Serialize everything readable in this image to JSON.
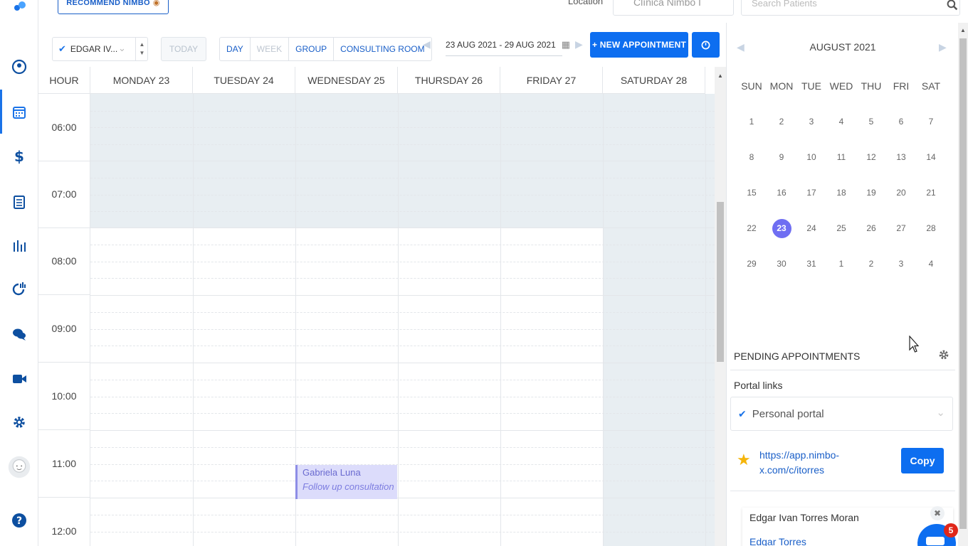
{
  "topbar": {
    "recommend_label": "RECOMMEND NIMBO",
    "location_label": "Location",
    "location_value": "Clínica Nimbo I",
    "search_placeholder": "Search Patients"
  },
  "toolbar": {
    "doctor_select": "EDGAR IV...",
    "today_label": "TODAY",
    "view_tabs": [
      "DAY",
      "WEEK",
      "GROUP",
      "CONSULTING ROOM"
    ],
    "date_range": "23 AUG 2021 - 29 AUG 2021",
    "new_appointment_label": "+ NEW APPOINTMENT"
  },
  "grid": {
    "hour_header": "HOUR",
    "days": [
      "MONDAY 23",
      "TUESDAY 24",
      "WEDNESDAY 25",
      "THURSDAY 26",
      "FRIDAY 27",
      "SATURDAY 28"
    ],
    "hours": [
      "06:00",
      "07:00",
      "08:00",
      "09:00",
      "10:00",
      "11:00",
      "12:00"
    ],
    "appointment": {
      "patient": "Gabriela Luna",
      "type": "Follow up consultation"
    }
  },
  "mini_calendar": {
    "month_title": "AUGUST 2021",
    "weekdays": [
      "SUN",
      "MON",
      "TUE",
      "WED",
      "THU",
      "FRI",
      "SAT"
    ],
    "weeks": [
      [
        "1",
        "2",
        "3",
        "4",
        "5",
        "6",
        "7"
      ],
      [
        "8",
        "9",
        "10",
        "11",
        "12",
        "13",
        "14"
      ],
      [
        "15",
        "16",
        "17",
        "18",
        "19",
        "20",
        "21"
      ],
      [
        "22",
        "23",
        "24",
        "25",
        "26",
        "27",
        "28"
      ],
      [
        "29",
        "30",
        "31",
        "1",
        "2",
        "3",
        "4"
      ]
    ],
    "selected_day": "23"
  },
  "pending": {
    "title": "PENDING APPOINTMENTS",
    "portal_links_label": "Portal links",
    "portal_select": "Personal portal",
    "portal_url": "https://app.nimbo-x.com/c/itorres",
    "copy_label": "Copy",
    "card_name": "Edgar Ivan Torres Moran",
    "card_link": "Edgar Torres"
  },
  "chat": {
    "badge_count": "5"
  },
  "colors": {
    "primary": "#0d6ef0",
    "appointment_bg": "#dcdcfb",
    "appointment_accent": "#8d8de6",
    "selected_day": "#6f6ef2",
    "off_hours": "#e8eef2"
  }
}
